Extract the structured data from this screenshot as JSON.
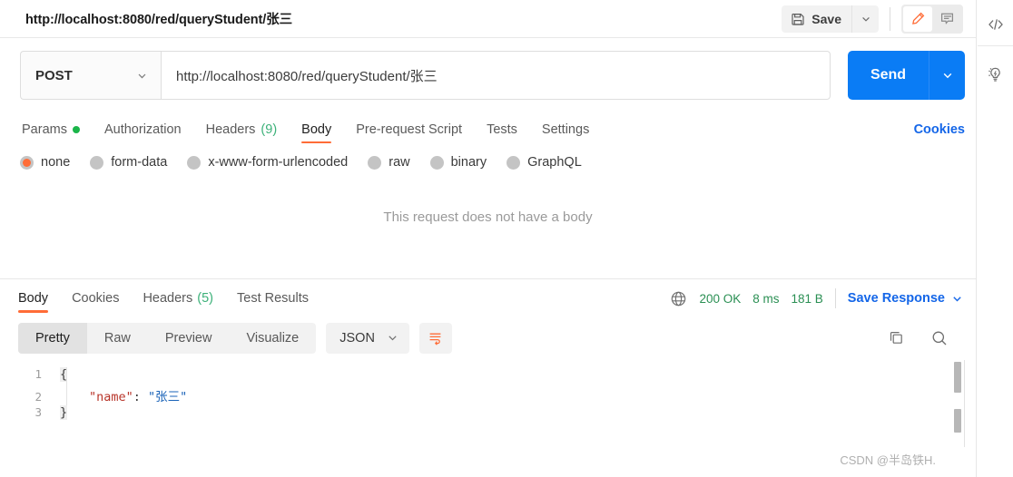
{
  "header": {
    "request_title": "http://localhost:8080/red/queryStudent/张三",
    "save_label": "Save",
    "save_icon": "floppy-disk-icon",
    "save_caret_icon": "chevron-down-icon",
    "edit_icon": "pencil-icon",
    "comment_icon": "comment-icon"
  },
  "url_bar": {
    "method": "POST",
    "method_caret_icon": "chevron-down-icon",
    "url": "http://localhost:8080/red/queryStudent/张三",
    "url_placeholder": "Enter request URL",
    "send_label": "Send",
    "send_caret_icon": "chevron-down-icon"
  },
  "request_tabs": [
    {
      "label": "Params",
      "badge": "dot",
      "active": false
    },
    {
      "label": "Authorization",
      "badge": "",
      "active": false
    },
    {
      "label": "Headers",
      "count": "(9)",
      "active": false
    },
    {
      "label": "Body",
      "badge": "",
      "active": true
    },
    {
      "label": "Pre-request Script",
      "badge": "",
      "active": false
    },
    {
      "label": "Tests",
      "badge": "",
      "active": false
    },
    {
      "label": "Settings",
      "badge": "",
      "active": false
    }
  ],
  "cookies_link": "Cookies",
  "body_types": [
    {
      "label": "none",
      "selected": true
    },
    {
      "label": "form-data",
      "selected": false
    },
    {
      "label": "x-www-form-urlencoded",
      "selected": false
    },
    {
      "label": "raw",
      "selected": false
    },
    {
      "label": "binary",
      "selected": false
    },
    {
      "label": "GraphQL",
      "selected": false
    }
  ],
  "body_empty_message": "This request does not have a body",
  "response": {
    "tabs": [
      {
        "label": "Body",
        "count": "",
        "active": true
      },
      {
        "label": "Cookies",
        "count": "",
        "active": false
      },
      {
        "label": "Headers",
        "count": "(5)",
        "active": false
      },
      {
        "label": "Test Results",
        "count": "",
        "active": false
      }
    ],
    "globe_icon": "globe-icon",
    "status": "200 OK",
    "time": "8 ms",
    "size": "181 B",
    "save_response_label": "Save Response",
    "save_response_caret_icon": "chevron-down-icon",
    "view_modes": [
      {
        "label": "Pretty",
        "active": true
      },
      {
        "label": "Raw",
        "active": false
      },
      {
        "label": "Preview",
        "active": false
      },
      {
        "label": "Visualize",
        "active": false
      }
    ],
    "format": "JSON",
    "format_caret_icon": "chevron-down-icon",
    "wrap_icon": "wrap-lines-icon",
    "copy_icon": "copy-icon",
    "search_icon": "search-icon",
    "code_lines": [
      {
        "num": "1",
        "brace": "{",
        "key": "",
        "colon": "",
        "value": ""
      },
      {
        "num": "2",
        "brace": "",
        "key": "\"name\"",
        "colon": ": ",
        "value": "\"张三\""
      },
      {
        "num": "3",
        "brace": "}",
        "key": "",
        "colon": "",
        "value": ""
      }
    ]
  },
  "right_rail": {
    "code_icon": "code-snippet-icon",
    "bulb_icon": "lightbulb-icon"
  },
  "watermark": "CSDN @半岛铁H.",
  "colors": {
    "accent_orange": "#ff6c37",
    "send_blue": "#0a7cf5",
    "link_blue": "#1466e8",
    "status_green": "#2a8f53",
    "params_dot_green": "#1bb54a"
  }
}
